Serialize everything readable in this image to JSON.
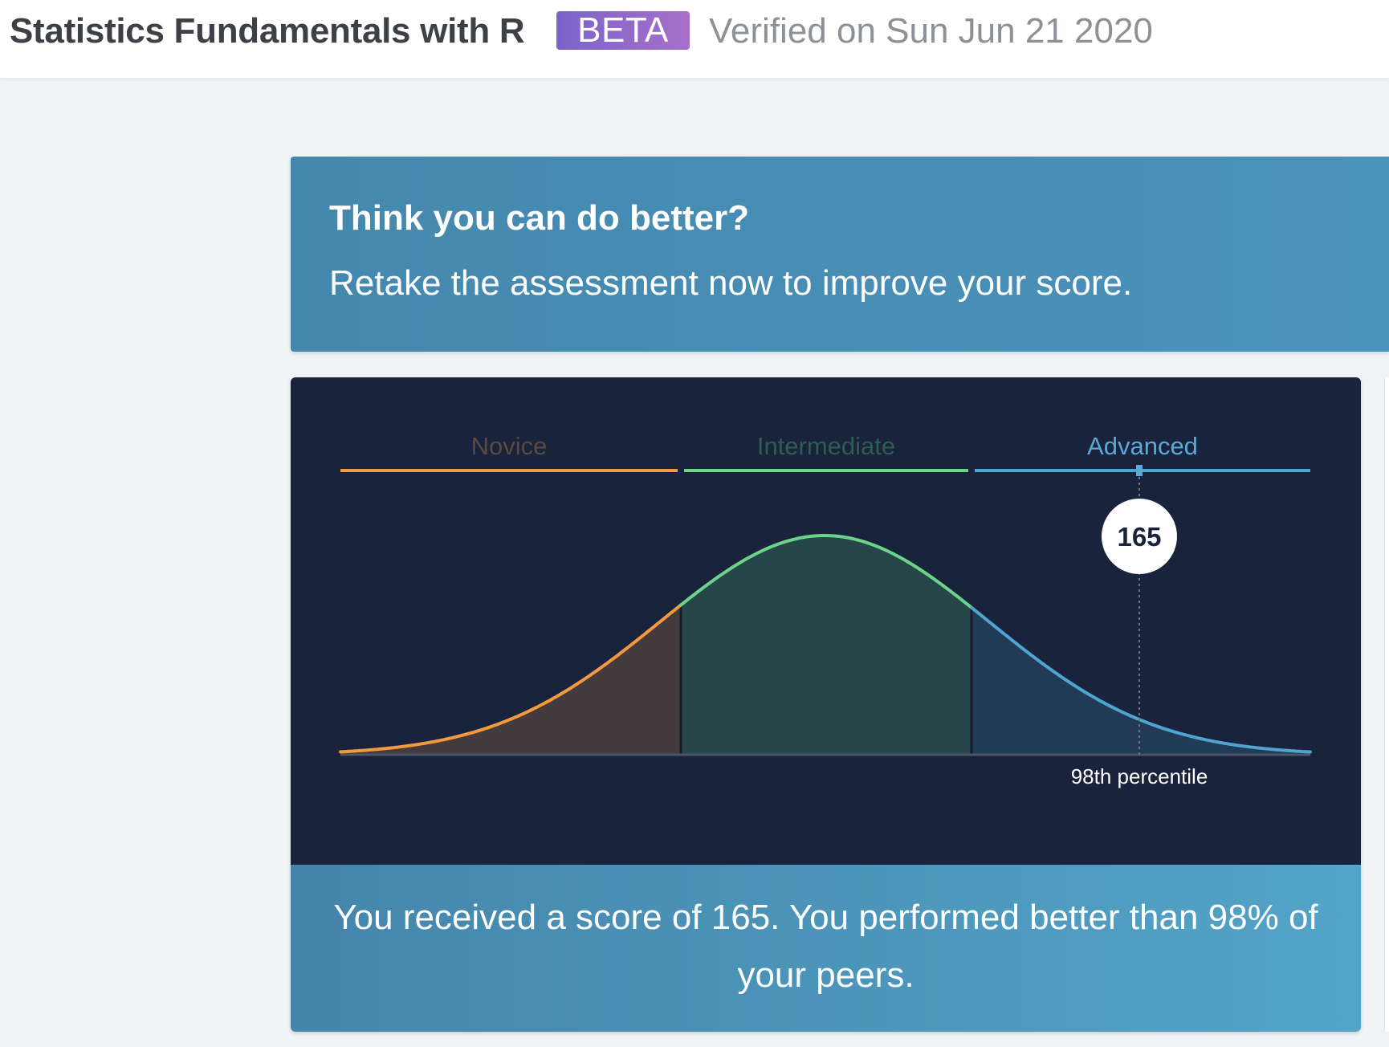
{
  "header": {
    "course_title": "Statistics Fundamentals with R",
    "badge": "BETA",
    "verified": "Verified on Sun Jun 21 2020"
  },
  "retake": {
    "title": "Think you can do better?",
    "subtitle": "Retake the assessment now to improve your score."
  },
  "chart_data": {
    "type": "area",
    "bands": [
      {
        "name": "Novice",
        "color": "#f29a3d",
        "fill": "#433b3d",
        "label_color": "#5a4a44"
      },
      {
        "name": "Intermediate",
        "color": "#6dd38a",
        "fill": "#26464a",
        "label_color": "#2f5c55"
      },
      {
        "name": "Advanced",
        "color": "#4fa4d0",
        "fill": "#213a55",
        "label_color": "#5aa9d6"
      }
    ],
    "score": 165,
    "percentile": 98,
    "percentile_label": "98th percentile"
  },
  "result": {
    "text": "You received a score of 165. You performed better than 98% of your peers."
  },
  "colors": {
    "chart_bg": "#19233b",
    "baseline": "#4b5566",
    "marker_bg": "#ffffff",
    "marker_text": "#19233b"
  }
}
